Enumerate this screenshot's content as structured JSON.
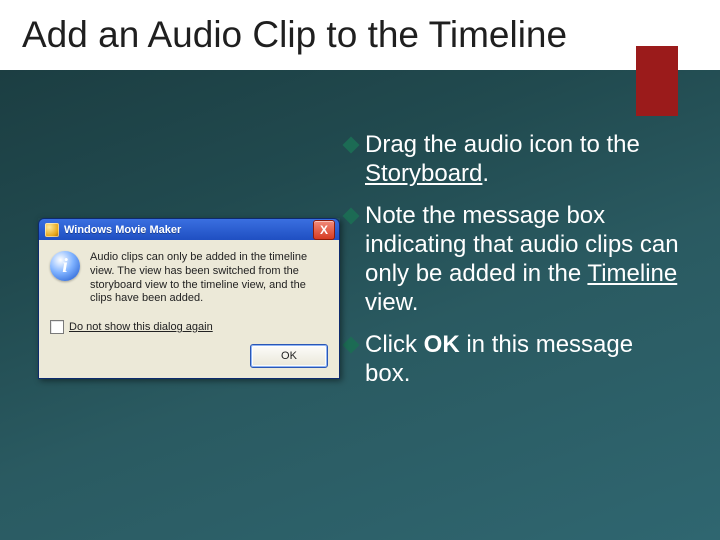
{
  "slide": {
    "title": "Add an Audio Clip to the Timeline"
  },
  "bullets": [
    {
      "lead": "Drag",
      "rest1": " the audio icon to the ",
      "u1": "Storyboard",
      "tail": "."
    },
    {
      "lead": "Note",
      "rest1": " the message box indicating that audio clips can only be added in the ",
      "u1": "Timeline",
      "tail": " view."
    },
    {
      "lead": "Click",
      "rest1": " ",
      "bold": "OK",
      "tail": " in this message box."
    }
  ],
  "dialog": {
    "title": "Windows Movie Maker",
    "close": "X",
    "info_glyph": "i",
    "message": "Audio clips can only be added in the timeline view. The view has been switched from the storyboard view to the timeline view, and the clips have been added.",
    "checkbox_label": "Do not show this dialog again",
    "ok_label": "OK"
  }
}
